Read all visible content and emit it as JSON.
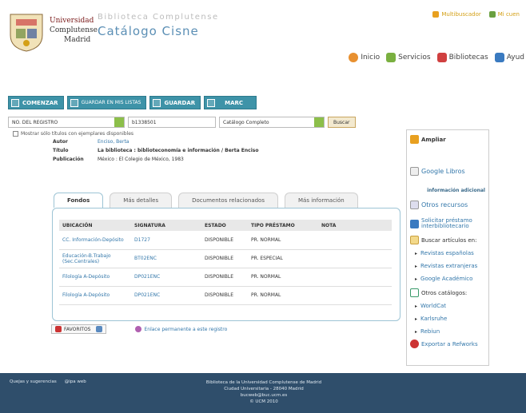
{
  "header": {
    "university_line1": "Universidad",
    "university_line2": "Complutense",
    "university_line3": "Madrid",
    "library_title": "Biblioteca Complutense",
    "catalog_title": "Catálogo Cisne",
    "top_links": [
      "Multibuscador",
      "Mi cuen"
    ],
    "nav_links": [
      "Inicio",
      "Servicios",
      "Bibliotecas",
      "Ayud"
    ]
  },
  "toolbar": {
    "comenzar": "COMENZAR",
    "guardar_listas": "GUARDAR EN MIS LISTAS",
    "guardar": "GUARDAR",
    "marc": "MARC"
  },
  "search": {
    "field_select": "NO. DEL REGISTRO",
    "query": "b1338501",
    "scope_select": "Catálogo Completo",
    "button": "Buscar",
    "checkbox_label": "Mostrar sólo títulos con ejemplares disponibles"
  },
  "record": {
    "author_label": "Autor",
    "author": "Enciso, Berta",
    "title_label": "Título",
    "title": "La biblioteca : biblioteconomía e información / Berta Enciso",
    "pub_label": "Publicación",
    "pub": "México : El Colegio de México, 1983"
  },
  "tabs": [
    "Fondos",
    "Más detalles",
    "Documentos relacionados",
    "Más información"
  ],
  "holdings": {
    "columns": [
      "UBICACIÓN",
      "SIGNATURA",
      "ESTADO",
      "TIPO PRÉSTAMO",
      "NOTA"
    ],
    "rows": [
      [
        "CC. Información-Depósito",
        "D1727",
        "DISPONIBLE",
        "PR. NORMAL",
        ""
      ],
      [
        "Educación-B.Trabajo (Sec.Centrales)",
        "BT02ENC",
        "DISPONIBLE",
        "PR. ESPECIAL",
        ""
      ],
      [
        "Filología A-Depósito",
        "DP021ENC",
        "DISPONIBLE",
        "PR. NORMAL",
        ""
      ],
      [
        "Filología A-Depósito",
        "DP021ENC",
        "DISPONIBLE",
        "PR. NORMAL",
        ""
      ]
    ]
  },
  "actions": {
    "favoritos": "FAVORITOS",
    "permalink": "Enlace permanente a este registro"
  },
  "sidebar": {
    "ampliar": "Ampliar",
    "google_libros": "Google Libros",
    "info_adicional": "información adicional",
    "otros_recursos": "Otros recursos",
    "solicitar": "Solicitar préstamo interbibliotecario",
    "buscar_articulos": "Buscar artículos en:",
    "articulos": [
      "Revistas españolas",
      "Revistas extranjeras",
      "Google Académico"
    ],
    "otros_catalogos": "Otros catálogos:",
    "catalogos": [
      "WorldCat",
      "Karlsruhe",
      "Rebiun"
    ],
    "exportar": "Exportar a Refworks"
  },
  "footer": {
    "links": [
      "Quejas y sugerencias",
      "@ipa web"
    ],
    "line1": "Biblioteca de la Universidad Complutense de Madrid",
    "line2": "Ciudad Universitaria - 28040 Madrid",
    "line3": "bucweb@buc.ucm.es",
    "line4": "© UCM 2010"
  },
  "colors": {
    "toolbar": "#3e93a8",
    "catalog_title": "#5b8fb5",
    "link": "#3377aa",
    "footer": "#2f4e6b"
  }
}
